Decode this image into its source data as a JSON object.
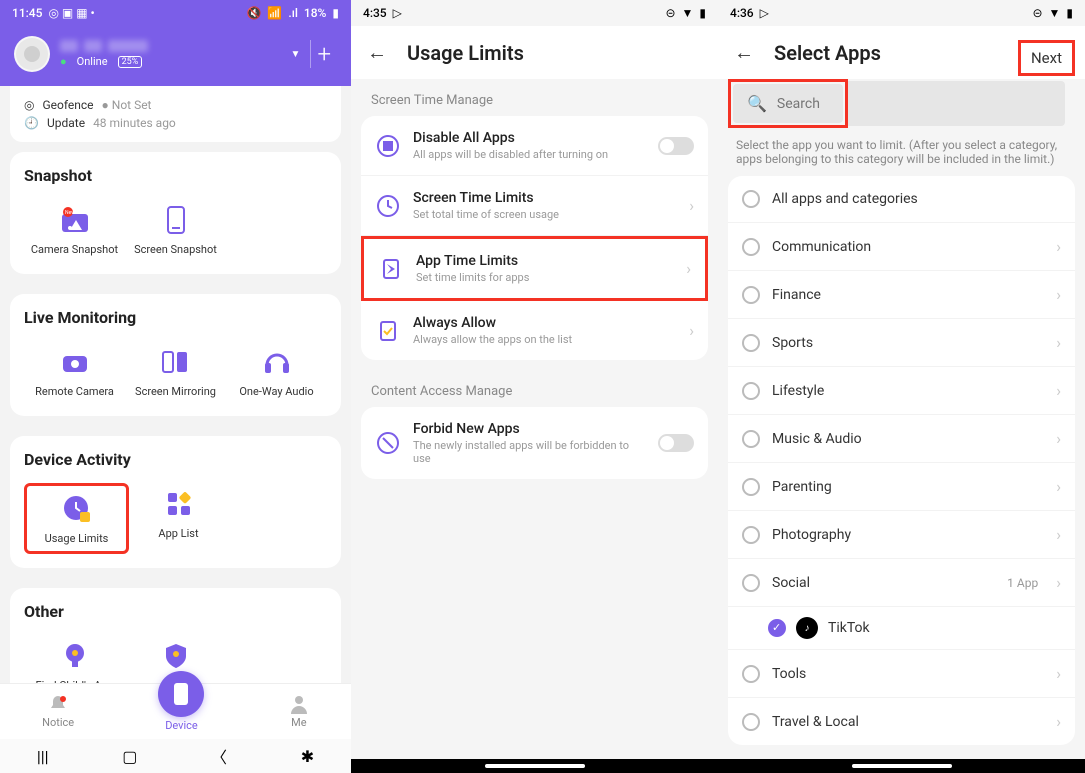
{
  "phone1": {
    "status": {
      "time": "11:45",
      "battery_pct": "18%",
      "signal": ".ıl"
    },
    "profile": {
      "online": "Online",
      "battery": "25%",
      "plus": "+"
    },
    "info": {
      "geofence_label": "Geofence",
      "geofence_value": "Not Set",
      "update_label": "Update",
      "update_value": "48 minutes ago"
    },
    "snapshot": {
      "title": "Snapshot",
      "items": [
        "Camera Snapshot",
        "Screen Snapshot"
      ]
    },
    "monitoring": {
      "title": "Live Monitoring",
      "items": [
        "Remote Camera",
        "Screen Mirroring",
        "One-Way Audio"
      ]
    },
    "activity": {
      "title": "Device Activity",
      "items": [
        "Usage Limits",
        "App List"
      ]
    },
    "other": {
      "title": "Other",
      "items": [
        "Find Child's App",
        "Check Permissions"
      ]
    },
    "nav": {
      "notice": "Notice",
      "device": "Device",
      "me": "Me"
    }
  },
  "phone2": {
    "status": {
      "time": "4:35"
    },
    "title": "Usage Limits",
    "section1": "Screen Time Manage",
    "rows": [
      {
        "t": "Disable All Apps",
        "s": "All apps will be disabled after turning on",
        "toggle": true
      },
      {
        "t": "Screen Time Limits",
        "s": "Set total time of screen usage",
        "chev": true
      },
      {
        "t": "App Time Limits",
        "s": "Set time limits for apps",
        "chev": true,
        "hl": true
      },
      {
        "t": "Always Allow",
        "s": "Always allow the apps on the list",
        "chev": true
      }
    ],
    "section2": "Content Access Manage",
    "rows2": [
      {
        "t": "Forbid New Apps",
        "s": "The newly installed apps will be forbidden to use",
        "toggle": true
      }
    ]
  },
  "phone3": {
    "status": {
      "time": "4:36"
    },
    "title": "Select Apps",
    "next": "Next",
    "search_placeholder": "Search",
    "desc": "Select the app you want to limit. (After you select a category, apps belonging to this category will be included in the limit.)",
    "cats": [
      {
        "name": "All apps and categories"
      },
      {
        "name": "Communication",
        "chev": true
      },
      {
        "name": "Finance",
        "chev": true
      },
      {
        "name": "Sports",
        "chev": true
      },
      {
        "name": "Lifestyle",
        "chev": true
      },
      {
        "name": "Music & Audio",
        "chev": true
      },
      {
        "name": "Parenting",
        "chev": true
      },
      {
        "name": "Photography",
        "chev": true
      },
      {
        "name": "Social",
        "count": "1 App",
        "chev": true,
        "sub": {
          "name": "TikTok",
          "checked": true
        }
      },
      {
        "name": "Tools",
        "chev": true
      },
      {
        "name": "Travel & Local",
        "chev": true
      }
    ]
  }
}
